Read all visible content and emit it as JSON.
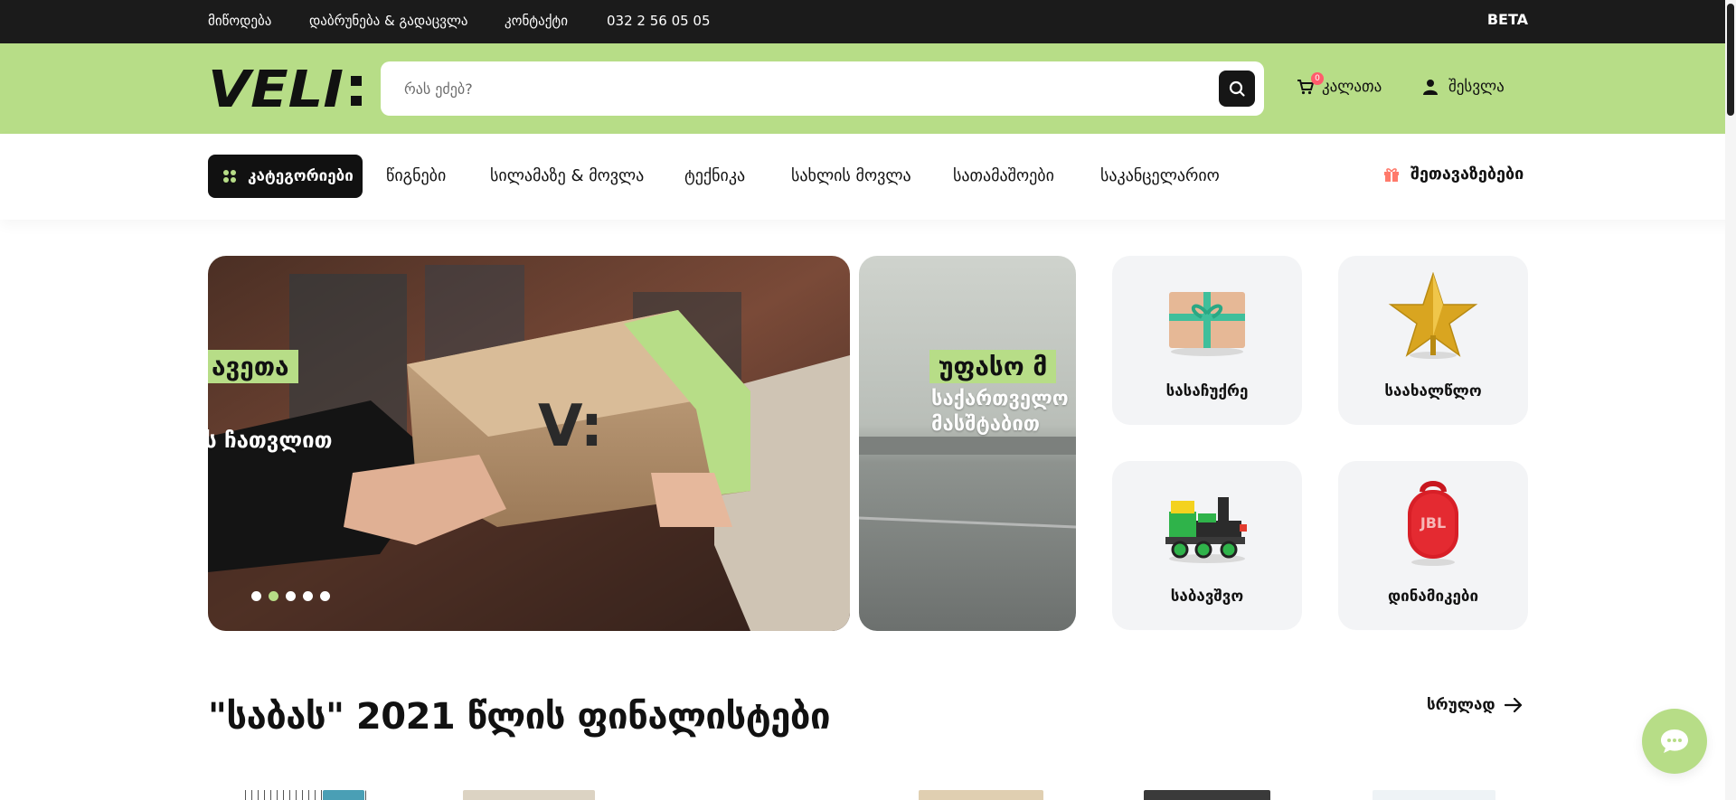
{
  "topbar": {
    "links": [
      "მიწოდება",
      "დაბრუნება & გადაცვლა",
      "კონტაქტი",
      "032 2 56 05 05"
    ],
    "beta": "BETA"
  },
  "header": {
    "logo_text": "VELI:",
    "search_placeholder": "რას ეძებ?",
    "cart_label": "კალათა",
    "cart_count": "0",
    "login_label": "შესვლა"
  },
  "nav": {
    "categories_label": "კატეგორიები",
    "items": [
      "წიგნები",
      "სილამაზე & მოვლა",
      "ტექნიკა",
      "სახლის მოვლა",
      "სათამაშოები",
      "საკანცელარიო"
    ],
    "offers_label": "შეთავაზებები"
  },
  "hero": {
    "main": {
      "tag": "ავეთა",
      "text": "ს ჩათვლით",
      "box_mark": "V:"
    },
    "side": {
      "tag": "უფასო მ",
      "line1": "საქართველო",
      "line2": "მასშტაბით"
    },
    "dots": 5,
    "active_dot": 1
  },
  "tiles": [
    {
      "label": "სასაჩუქრე",
      "icon": "gift-icon"
    },
    {
      "label": "საახალწლო",
      "icon": "star-icon"
    },
    {
      "label": "საბავშვო",
      "icon": "toy-train-icon"
    },
    {
      "label": "დინამიკები",
      "icon": "speaker-icon",
      "brand": "JBL"
    }
  ],
  "section": {
    "title": "\"საბას\" 2021 წლის ფინალისტები",
    "see_all": "სრულად"
  },
  "colors": {
    "accent": "#b7dd87",
    "topbar": "#1b1b1b",
    "dark": "#111111",
    "tile_bg": "#f3f4f6",
    "badge": "#ff5c6c"
  }
}
